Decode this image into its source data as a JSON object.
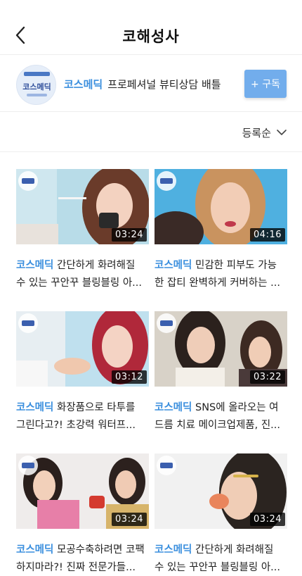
{
  "header": {
    "title": "코해성사"
  },
  "channel": {
    "logo_text": "코스메딕",
    "brand": "코스메딕",
    "description": "프로페셔널 뷰티상담 배틀",
    "subscribe_label": "+ 구독"
  },
  "sort": {
    "label": "등록순"
  },
  "videos": [
    {
      "brand": "코스메딕",
      "line1": "간단하게 화려해질",
      "line2": "수 있는 꾸안꾸 블링블링 아...",
      "duration": "03:24"
    },
    {
      "brand": "코스메딕",
      "line1": "민감한 피부도 가능",
      "line2": "한 잡티 완벽하게 커버하는 ...",
      "duration": "04:16"
    },
    {
      "brand": "코스메딕",
      "line1": "화장품으로 타투를",
      "line2": "그린다고?! 초강력 워터프...",
      "duration": "03:12"
    },
    {
      "brand": "코스메딕",
      "line1": "SNS에 올라오는 여",
      "line2": "드름 치료 메이크업제품, 진...",
      "duration": "03:22"
    },
    {
      "brand": "코스메딕",
      "line1": "모공수축하려면 코팩",
      "line2": "하지마라?! 진짜 전문가들...",
      "duration": "03:24"
    },
    {
      "brand": "코스메딕",
      "line1": "간단하게 화려해질",
      "line2": "수 있는 꾸안꾸 블링블링 아...",
      "duration": "03:24"
    }
  ],
  "colors": {
    "brand": "#3b8fde",
    "subscribe": "#72adec"
  },
  "icons": {
    "back": "chevron-left-icon",
    "sort": "chevron-down-icon"
  }
}
